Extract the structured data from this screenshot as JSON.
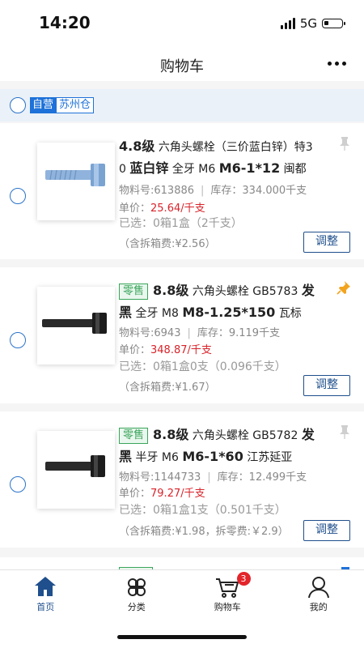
{
  "status_bar": {
    "time": "14:20",
    "network": "5G"
  },
  "nav": {
    "title": "购物车"
  },
  "store": {
    "self_tag": "自营",
    "city_tag": "苏州仓"
  },
  "products": [
    {
      "grade": "4.8级",
      "name_a": "六角头螺栓（三价蓝白锌）特3",
      "name_b": "0",
      "finish": "蓝白锌",
      "thread": "全牙 M6",
      "spec": "M6-1*12",
      "brand": "闽都",
      "material_no": "物料号:613886",
      "stock": "库存：334.000千支",
      "unit_price_label": "单价：",
      "unit_price": "25.64/千支",
      "selected": "已选：0箱1盒（2千支）",
      "fee": "（含拆箱费:¥2.56）",
      "button": "调整"
    },
    {
      "retail_tag": "零售",
      "grade": "8.8级",
      "name_a": "六角头螺栓 GB5783",
      "finish_a": "发",
      "finish_b": "黑",
      "thread": "全牙 M8",
      "spec": "M8-1.25*150",
      "brand": "瓦标",
      "material_no": "物料号:6943",
      "stock": "库存：9.119千支",
      "unit_price_label": "单价：",
      "unit_price": "348.87/千支",
      "selected": "已选：0箱1盒0支（0.096千支）",
      "fee": "（含拆箱费:¥1.67）",
      "button": "调整"
    },
    {
      "retail_tag": "零售",
      "grade": "8.8级",
      "name_a": "六角头螺栓 GB5782",
      "finish_a": "发",
      "finish_b": "黑",
      "thread": "半牙 M6",
      "spec": "M6-1*60",
      "brand": "江苏延亚",
      "material_no": "物料号:1144733",
      "stock": "库存：12.499千支",
      "unit_price_label": "单价：",
      "unit_price": "79.27/千支",
      "selected": "已选：0箱1盒1支（0.501千支）",
      "fee": "（含拆箱费:¥1.98，拆零费:￥2.9）",
      "button": "调整"
    }
  ],
  "tab_bar": {
    "home": "首页",
    "category": "分类",
    "cart": "购物车",
    "cart_badge": "3",
    "mine": "我的"
  },
  "colors": {
    "accent": "#1f4f8c",
    "price": "#d8232a",
    "retail": "#3aa55a"
  },
  "icons": [
    "signal-icon",
    "battery-icon",
    "more-icon",
    "pin-icon",
    "home-icon",
    "category-icon",
    "cart-icon",
    "user-icon"
  ]
}
